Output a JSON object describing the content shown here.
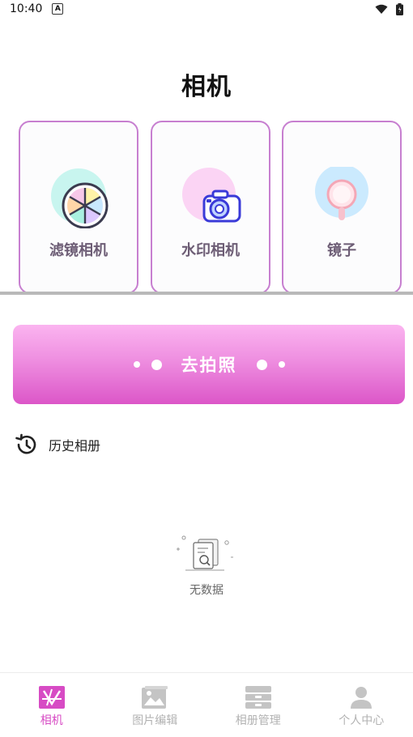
{
  "status_bar": {
    "time": "10:40"
  },
  "page": {
    "title": "相机"
  },
  "cards": [
    {
      "label": "滤镜相机",
      "icon": "color-wheel-icon"
    },
    {
      "label": "水印相机",
      "icon": "camera-icon"
    },
    {
      "label": "镜子",
      "icon": "hand-mirror-icon"
    }
  ],
  "shoot_button": {
    "label": "去拍照"
  },
  "history": {
    "label": "历史相册",
    "icon": "history-icon"
  },
  "empty_state": {
    "text": "无数据",
    "icon": "empty-document-icon"
  },
  "bottom_nav": {
    "items": [
      {
        "label": "相机",
        "icon": "camera-tab-icon",
        "active": true
      },
      {
        "label": "图片编辑",
        "icon": "image-icon",
        "active": false
      },
      {
        "label": "相册管理",
        "icon": "archive-icon",
        "active": false
      },
      {
        "label": "个人中心",
        "icon": "user-icon",
        "active": false
      }
    ]
  },
  "colors": {
    "accent": "#d74bc4",
    "card_border": "#c77fd0",
    "button_gradient_top": "#fbb4f0",
    "button_gradient_bottom": "#dc56c8",
    "inactive_nav": "#b2b2b2"
  }
}
